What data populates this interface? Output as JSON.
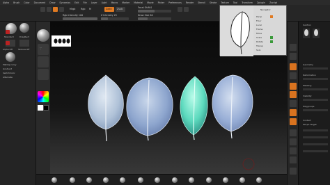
{
  "menubar": {
    "items": [
      "Alpha",
      "Brush",
      "Color",
      "Document",
      "Draw",
      "Dynamics",
      "Edit",
      "File",
      "Layer",
      "Light",
      "Macro",
      "Marker",
      "Material",
      "Movie",
      "Picker",
      "Preferences",
      "Render",
      "Stencil",
      "Stroke",
      "Texture",
      "Tool",
      "Transform",
      "Zplugin",
      "Zscript"
    ]
  },
  "toolbar": {
    "labels": [
      "Mrgb",
      "Rgb",
      "M",
      "Zadd",
      "Zsub",
      "Focal Shift 0",
      "Draw Size 64",
      "Rgb Intensity 100",
      "Z Intensity 25"
    ]
  },
  "left_tray": {
    "labels": [
      "Standard",
      "DragRect",
      "Alpha Off",
      "Texture Off",
      "MatCap Gray",
      "Gradient",
      "SwitchColor",
      "Alternate"
    ]
  },
  "right_tray": {
    "labels": [
      "SubTool",
      "Geometry",
      "Deformation",
      "Masking",
      "Visibility",
      "Polygroups",
      "Contact",
      "Morph Target"
    ]
  },
  "navigator": {
    "labels": [
      "Navigator",
      "Persp",
      "Floor",
      "Local",
      "Frame",
      "Move",
      "Scale",
      "Rotate",
      "Transp",
      "Solo"
    ]
  },
  "viewport": {
    "leaves": [
      {
        "name": "leaf-1",
        "color": "#b7c7dc"
      },
      {
        "name": "leaf-2",
        "color": "#95abd0"
      },
      {
        "name": "leaf-3",
        "color": "#6fe0c6"
      },
      {
        "name": "leaf-4",
        "color": "#9fb4d8"
      }
    ]
  },
  "colors": {
    "accent": "#e07a22",
    "background": "#1e1e1e",
    "panel": "#262626"
  },
  "icons": [
    "sphere-icon",
    "alpha-brush-icon",
    "color-picker-icon",
    "navigator-leaf-icon",
    "floor-icon",
    "transform-icon"
  ]
}
